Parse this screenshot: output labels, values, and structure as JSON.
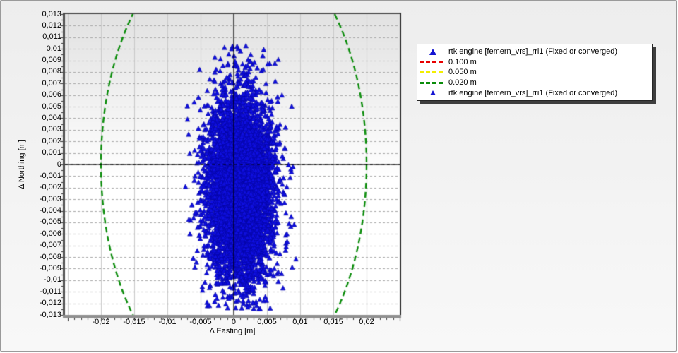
{
  "window": {
    "background_top": "#ededed",
    "background_bottom": "#f8f8f8",
    "border_color": "#9a9a9a"
  },
  "chart_data": {
    "type": "scatter",
    "title": "",
    "xlabel": "Δ Easting [m]",
    "ylabel": "Δ Northing [m]",
    "xlim": [
      -0.025425,
      0.025
    ],
    "ylim": [
      -0.013,
      0.013
    ],
    "x_ticks": {
      "values": [
        -0.02,
        -0.015,
        -0.01,
        -0.005,
        0,
        0.005,
        0.01,
        0.015,
        0.02
      ],
      "labels": [
        "-0,02",
        "-0,015",
        "-0,01",
        "-0,005",
        "0",
        "0,005",
        "0,01",
        "0,015",
        "0,02"
      ]
    },
    "x_minor_step": 0.001,
    "y_ticks": {
      "values": [
        0.013,
        0.012,
        0.011,
        0.01,
        0.009,
        0.008,
        0.007,
        0.006,
        0.005,
        0.004,
        0.003,
        0.002,
        0.001,
        0,
        -0.001,
        -0.002,
        -0.003,
        -0.004,
        -0.005,
        -0.006,
        -0.007,
        -0.008,
        -0.009,
        -0.01,
        -0.011,
        -0.012,
        -0.013
      ],
      "labels": [
        "0,013",
        "0,012",
        "0,011",
        "0,01",
        "0,009",
        "0,008",
        "0,007",
        "0,006",
        "0,005",
        "0,004",
        "0,003",
        "0,002",
        "0,001",
        "0",
        "-0,001",
        "-0,002",
        "-0,003",
        "-0,004",
        "-0,005",
        "-0,006",
        "-0,007",
        "-0,008",
        "-0,009",
        "-0,01",
        "-0,011",
        "-0,012",
        "-0,013"
      ]
    },
    "y_minor_step": 0.0005,
    "grid": {
      "vertical": {
        "step": 0.005,
        "color": "#c9c9c9",
        "style": "solid"
      },
      "horizontal": {
        "step": 0.001,
        "color": "#a8a8a8",
        "style": "dashed"
      }
    },
    "zero_axes_color": "#000000",
    "plot_background": {
      "gradient_top": "#e2e2e2",
      "gradient_bottom": "#ffffff"
    },
    "tolerance_circles": [
      {
        "label": "0.100 m",
        "radius_m": 0.1,
        "color": "#e80000",
        "visible_in_plot": false
      },
      {
        "label": "0.050 m",
        "radius_m": 0.05,
        "color": "#f2ee00",
        "visible_in_plot": false
      },
      {
        "label": "0.020 m",
        "radius_m": 0.02,
        "color": "#0a8c0a",
        "visible_in_plot": true
      }
    ],
    "series": [
      {
        "name": "rtk engine [femern_vrs]_rri1 (Fixed or converged)",
        "marker": "triangle-up",
        "color": "#0f0fe0",
        "edge_color": "#0505a0",
        "cloud_model": {
          "seed": 1337,
          "components": [
            {
              "n": 6000,
              "mean": [
                0.0009,
                -0.002
              ],
              "sigma": [
                0.0024,
                0.0038
              ]
            },
            {
              "n": 320,
              "mean": [
                0.0008,
                -0.0022
              ],
              "sigma": [
                0.0034,
                0.0055
              ]
            }
          ],
          "clip_x": [
            -0.0073,
            0.0094
          ],
          "clip_y": [
            -0.0126,
            0.0103
          ]
        },
        "outlier_points": [
          [
            -0.0014,
            0.0101
          ],
          [
            -0.0003,
            0.01
          ],
          [
            0.0005,
            0.0102
          ],
          [
            0.001,
            0.0098
          ],
          [
            -0.002,
            0.0091
          ],
          [
            0.0002,
            0.0089
          ],
          [
            -0.0009,
            0.0086
          ],
          [
            0.0015,
            0.008
          ],
          [
            0.0078,
            0.0032
          ],
          [
            0.0086,
            -0.0004
          ],
          [
            0.0091,
            -0.0052
          ],
          [
            0.0088,
            -0.0089
          ],
          [
            0.008,
            -0.006
          ],
          [
            -0.0068,
            0.0026
          ],
          [
            -0.0063,
            -0.0035
          ],
          [
            -0.0059,
            0.0012
          ],
          [
            -0.0066,
            -0.006
          ],
          [
            0.0003,
            -0.0124
          ],
          [
            0.0014,
            -0.0118
          ],
          [
            -0.0002,
            -0.0115
          ],
          [
            0.0028,
            -0.0106
          ],
          [
            -0.0019,
            -0.0103
          ],
          [
            0.0007,
            -0.0109
          ]
        ]
      }
    ]
  },
  "legend": {
    "items": [
      {
        "sample": "triangle-large",
        "color": "#1414d2",
        "label": "rtk engine [femern_vrs]_rri1 (Fixed or converged)"
      },
      {
        "sample": "dash",
        "color": "#e80000",
        "label": "0.100 m"
      },
      {
        "sample": "dash",
        "color": "#f2ee00",
        "label": "0.050 m"
      },
      {
        "sample": "dash",
        "color": "#0a8c0a",
        "label": "0.020 m"
      },
      {
        "sample": "triangle-small",
        "color": "#1414d2",
        "label": "rtk engine [femern_vrs]_rri1 (Fixed or converged)"
      }
    ]
  }
}
